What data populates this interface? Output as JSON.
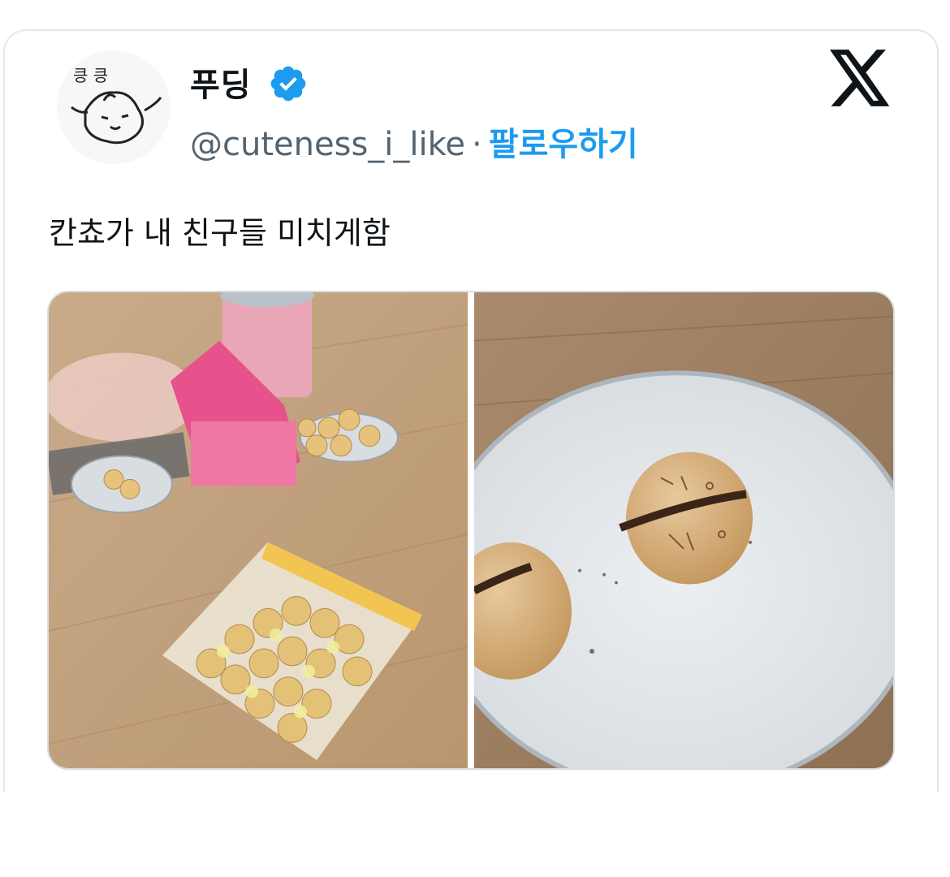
{
  "tweet": {
    "author": {
      "avatar_caption": "킁 킁",
      "display_name": "푸딩",
      "verified": true,
      "handle": "@cuteness_i_like",
      "separator": "·",
      "follow_label": "팔로우하기"
    },
    "platform_icon": "x-logo-icon",
    "text": "칸쵸가 내 친구들 미치게함",
    "media": [
      {
        "name": "photo-cookies-on-floor"
      },
      {
        "name": "photo-cookie-closeup"
      }
    ]
  },
  "colors": {
    "accent": "#1d9bf0",
    "text_primary": "#0f1419",
    "text_secondary": "#536471",
    "border": "#e4e7ea"
  }
}
